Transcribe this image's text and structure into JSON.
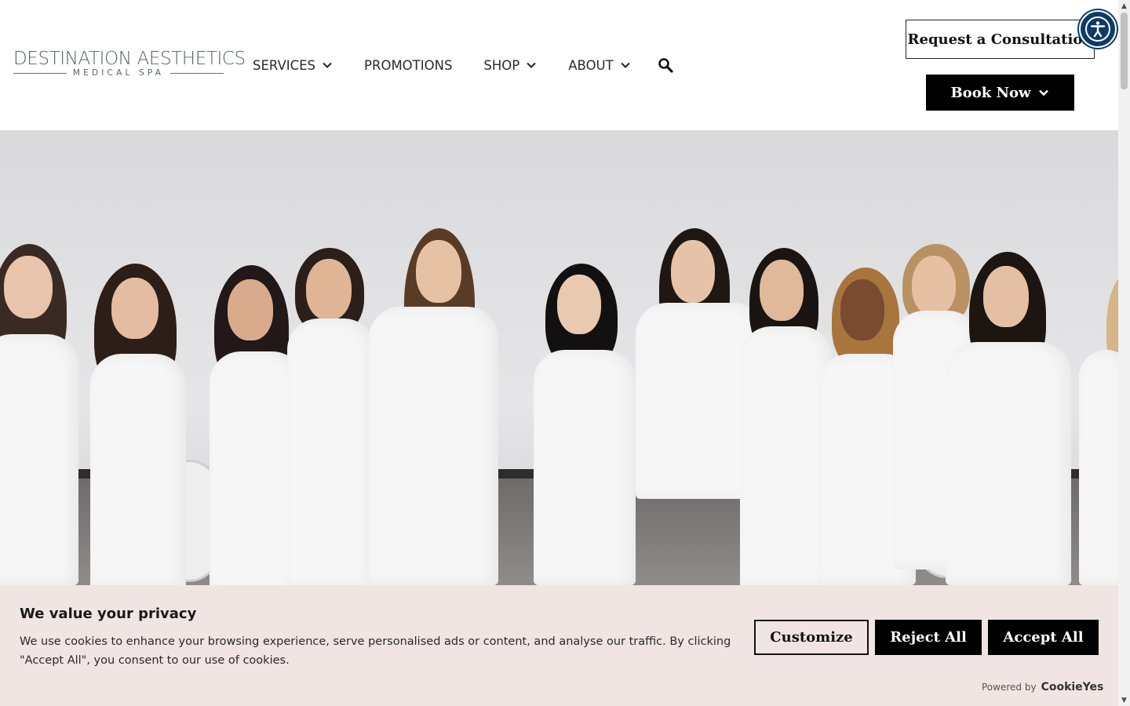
{
  "logo": {
    "main": "DESTINATION AESTHETICS",
    "sub": "MEDICAL SPA"
  },
  "nav": [
    {
      "label": "SERVICES",
      "dropdown": true
    },
    {
      "label": "PROMOTIONS",
      "dropdown": false
    },
    {
      "label": "SHOP",
      "dropdown": true
    },
    {
      "label": "ABOUT",
      "dropdown": true
    }
  ],
  "header_buttons": {
    "consult": "Request a Consultation",
    "book": "Book Now"
  },
  "cookie": {
    "title": "We value your privacy",
    "text": "We use cookies to enhance your browsing experience, serve personalised ads or content, and analyse our traffic. By clicking \"Accept All\", you consent to our use of cookies.",
    "customize": "Customize",
    "reject": "Reject All",
    "accept": "Accept All",
    "powered_by": "Powered by",
    "brand": "CookieYes"
  },
  "colors": {
    "accent": "#0d3b66",
    "banner_bg": "#f0e5e3",
    "button_dark": "#000000"
  }
}
